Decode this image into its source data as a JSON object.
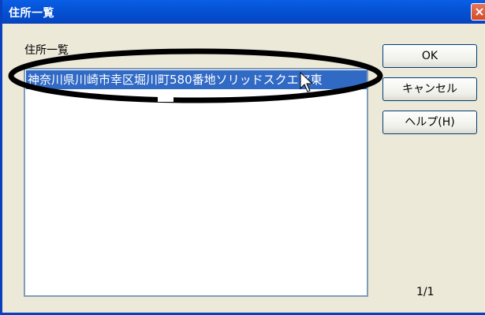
{
  "window": {
    "title": "住所一覧",
    "close_glyph": "×"
  },
  "address_group": {
    "label": "住所一覧"
  },
  "address_list": {
    "items": [
      {
        "text": "神奈川県川崎市幸区堀川町580番地ソリッドスクエア東",
        "selected": true
      }
    ]
  },
  "buttons": {
    "ok": "OK",
    "cancel": "キャンセル",
    "help": "ヘルプ(H)"
  },
  "pager": {
    "text": "1/1"
  },
  "colors": {
    "titlebar": "#0553d6",
    "selection": "#316ac5",
    "annotation": "#000000"
  }
}
